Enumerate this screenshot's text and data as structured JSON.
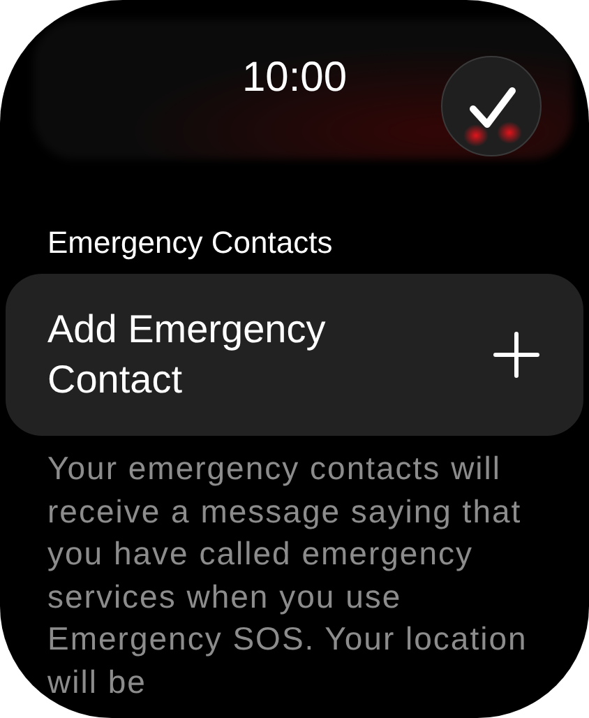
{
  "time": "10:00",
  "section_header": "Emergency Contacts",
  "add_row": {
    "label": "Add Emergency Contact"
  },
  "footer": "Your emergency contacts will receive a message saying that you have called emergency services when you use Emergency SOS. Your location will be"
}
